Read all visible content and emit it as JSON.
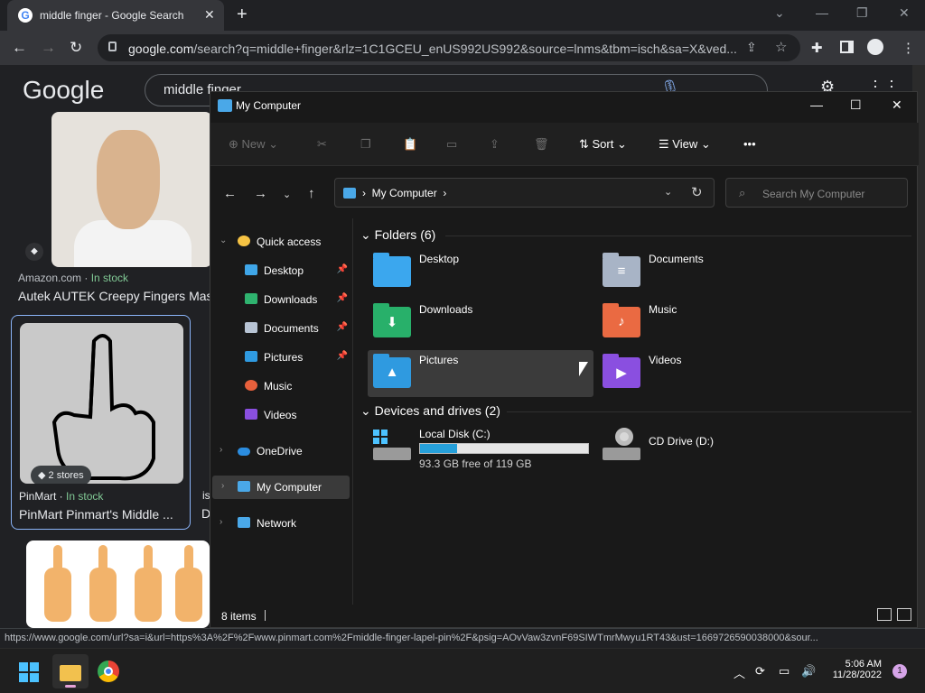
{
  "browser": {
    "tab_title": "middle finger - Google Search",
    "tab_close": "✕",
    "new_tab": "+",
    "window_controls": [
      "⌄",
      "—",
      "❐",
      "✕"
    ],
    "back": "←",
    "forward": "→",
    "reload": "↻",
    "url_domain": "google.com",
    "url_path": "/search?q=middle+finger&rlz=1C1GCEU_enUS992US992&source=lnms&tbm=isch&sa=X&ved...",
    "icons": [
      "share-icon",
      "star-icon",
      "extensions-icon",
      "sidepanel-icon",
      "profile-icon",
      "menu-icon"
    ]
  },
  "google": {
    "logo": "Google",
    "query": "middle finger",
    "results": [
      {
        "source": "Amazon.com",
        "stock": "In stock",
        "title": "Autek AUTEK Creepy Fingers Mas"
      },
      {
        "badge": "2 stores",
        "source": "PinMart",
        "stock": "In stock",
        "title": "PinMart Pinmart's Middle ..."
      }
    ],
    "side_letters": [
      "is",
      "D"
    ]
  },
  "status_url": "https://www.google.com/url?sa=i&url=https%3A%2F%2Fwww.pinmart.com%2Fmiddle-finger-lapel-pin%2F&psig=AOvVaw3zvnF69SIWTmrMwyu1RT43&ust=1669726590038000&sour...",
  "explorer": {
    "title": "My Computer",
    "controls": [
      "—",
      "☐",
      "✕"
    ],
    "commands": {
      "new": "New",
      "sort": "Sort",
      "view": "View",
      "more": "•••"
    },
    "address": "My Computer",
    "search_placeholder": "Search My Computer",
    "nav_pane": {
      "quick_access": "Quick access",
      "quick_items": [
        "Desktop",
        "Downloads",
        "Documents",
        "Pictures",
        "Music",
        "Videos"
      ],
      "onedrive": "OneDrive",
      "my_computer": "My Computer",
      "network": "Network"
    },
    "folders_header": "Folders (6)",
    "folders": [
      "Desktop",
      "Documents",
      "Downloads",
      "Music",
      "Pictures",
      "Videos"
    ],
    "drives_header": "Devices and drives (2)",
    "drives": [
      {
        "name": "Local Disk (C:)",
        "free": "93.3 GB free of 119 GB",
        "used_fraction": 0.22
      },
      {
        "name": "CD Drive (D:)"
      }
    ],
    "status": "8 items",
    "colors": {
      "accent": "#4aa8e8",
      "drive_bar": "#26a0da"
    }
  },
  "taskbar": {
    "time": "5:06 AM",
    "date": "11/28/2022",
    "notifications": "1"
  }
}
